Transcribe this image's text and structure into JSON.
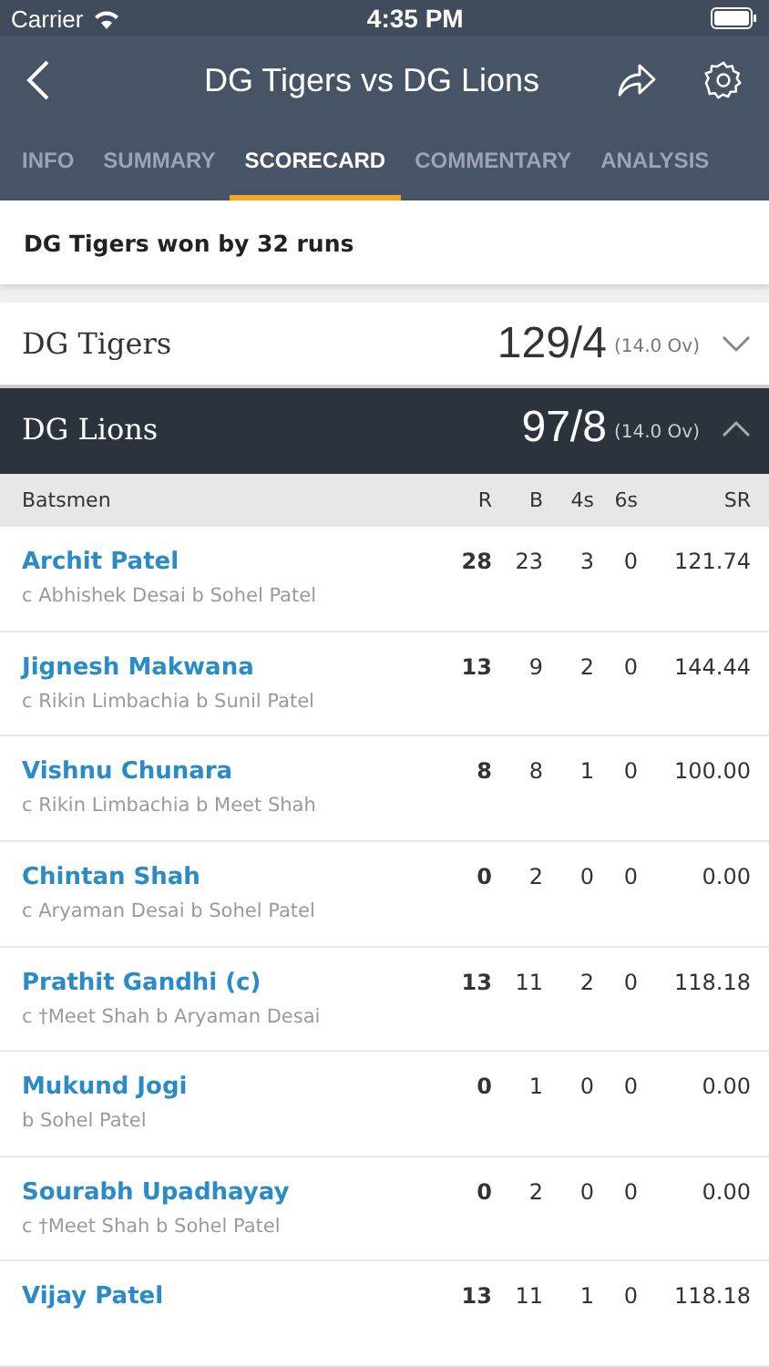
{
  "status_bar": {
    "carrier": "Carrier",
    "time": "4:35 PM"
  },
  "header": {
    "title": "DG Tigers vs DG Lions"
  },
  "tabs": [
    {
      "label": "INFO",
      "selected": false
    },
    {
      "label": "SUMMARY",
      "selected": false
    },
    {
      "label": "SCORECARD",
      "selected": true
    },
    {
      "label": "COMMENTARY",
      "selected": false
    },
    {
      "label": "ANALYSIS",
      "selected": false
    }
  ],
  "result": "DG Tigers won by 32 runs",
  "innings": [
    {
      "team": "DG Tigers",
      "score": "129/4",
      "overs": "(14.0 Ov)",
      "expanded": false
    },
    {
      "team": "DG Lions",
      "score": "97/8",
      "overs": "(14.0 Ov)",
      "expanded": true
    }
  ],
  "batting_table": {
    "columns": [
      "Batsmen",
      "R",
      "B",
      "4s",
      "6s",
      "SR"
    ],
    "rows": [
      {
        "name": "Archit Patel",
        "dismissal": "c Abhishek Desai b Sohel Patel",
        "r": "28",
        "b": "23",
        "fours": "3",
        "sixes": "0",
        "sr": "121.74"
      },
      {
        "name": "Jignesh Makwana",
        "dismissal": "c Rikin Limbachia b Sunil Patel",
        "r": "13",
        "b": "9",
        "fours": "2",
        "sixes": "0",
        "sr": "144.44"
      },
      {
        "name": "Vishnu Chunara",
        "dismissal": "c Rikin Limbachia b Meet Shah",
        "r": "8",
        "b": "8",
        "fours": "1",
        "sixes": "0",
        "sr": "100.00"
      },
      {
        "name": "Chintan Shah",
        "dismissal": "c Aryaman Desai b Sohel Patel",
        "r": "0",
        "b": "2",
        "fours": "0",
        "sixes": "0",
        "sr": "0.00"
      },
      {
        "name": "Prathit Gandhi (c)",
        "dismissal": "c †Meet Shah b Aryaman Desai",
        "r": "13",
        "b": "11",
        "fours": "2",
        "sixes": "0",
        "sr": "118.18"
      },
      {
        "name": "Mukund Jogi",
        "dismissal": "b Sohel Patel",
        "r": "0",
        "b": "1",
        "fours": "0",
        "sixes": "0",
        "sr": "0.00"
      },
      {
        "name": "Sourabh Upadhayay",
        "dismissal": "c †Meet Shah b Sohel Patel",
        "r": "0",
        "b": "2",
        "fours": "0",
        "sixes": "0",
        "sr": "0.00"
      },
      {
        "name": "Vijay Patel",
        "r": "13",
        "b": "11",
        "fours": "1",
        "sixes": "0",
        "sr": "118.18"
      }
    ]
  }
}
